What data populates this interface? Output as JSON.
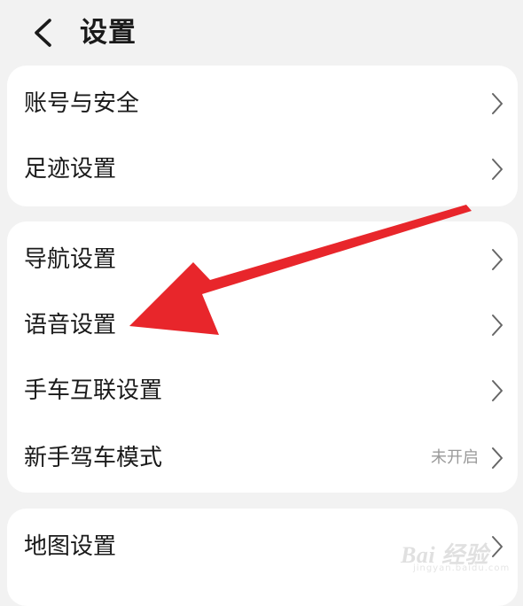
{
  "header": {
    "title": "设置",
    "back_icon": "chevron-left-icon"
  },
  "sections": [
    {
      "items": [
        {
          "label": "账号与安全",
          "icon": "chevron-right-icon"
        },
        {
          "label": "足迹设置",
          "icon": "chevron-right-icon"
        }
      ]
    },
    {
      "items": [
        {
          "label": "导航设置",
          "icon": "chevron-right-icon"
        },
        {
          "label": "语音设置",
          "icon": "chevron-right-icon"
        },
        {
          "label": "手车互联设置",
          "icon": "chevron-right-icon"
        },
        {
          "label": "新手驾车模式",
          "status": "未开启",
          "icon": "chevron-right-icon"
        }
      ]
    },
    {
      "items": [
        {
          "label": "地图设置",
          "icon": "chevron-right-icon"
        }
      ]
    }
  ],
  "annotation": {
    "arrow_color": "#e8262b",
    "points_to": "语音设置"
  },
  "watermark": {
    "text": "Bai 经验",
    "subtext": "jingyan.baidu.com"
  }
}
